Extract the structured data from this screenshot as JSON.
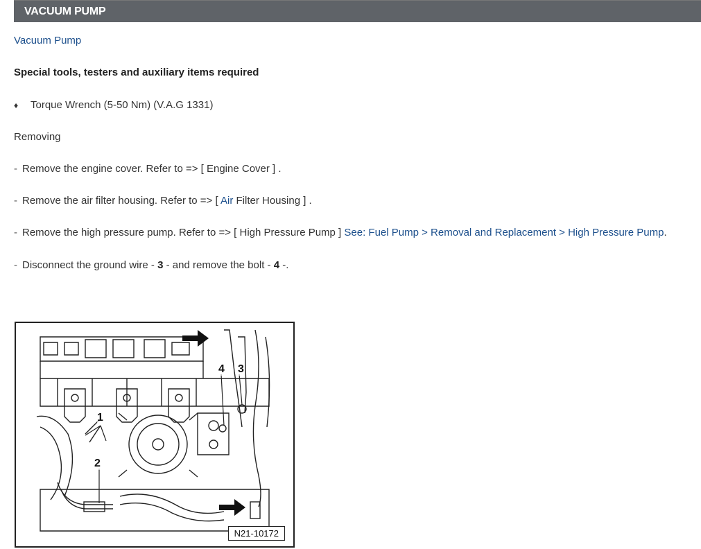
{
  "header": {
    "title": "VACUUM PUMP"
  },
  "doc": {
    "title": "Vacuum Pump",
    "tools_heading": "Special tools, testers and auxiliary items required",
    "tool_item": "Torque Wrench (5-50 Nm) (V.A.G 1331)",
    "removing_label": "Removing",
    "steps": [
      {
        "dash": "-",
        "text_a": "Remove the engine cover. Refer to => [ Engine Cover ] ."
      },
      {
        "dash": "-",
        "text_a": "Remove the air filter housing. Refer to => [ ",
        "link": "Air",
        "text_b": " Filter Housing ] ."
      },
      {
        "dash": "-",
        "text_a": "Remove the high pressure pump. Refer to => [ High Pressure Pump ] ",
        "link": "See: Fuel Pump > Removal and Replacement > High Pressure Pump",
        "text_b": "."
      },
      {
        "dash": "-",
        "text_a": "Disconnect the ground wire - ",
        "b1": "3",
        "text_b": " - and remove the bolt - ",
        "b2": "4",
        "text_c": " -."
      }
    ]
  },
  "figure": {
    "label": "N21-10172",
    "callouts": [
      "1",
      "2",
      "3",
      "4"
    ]
  },
  "icons": {
    "bullet": "diamond-bullet-icon",
    "arrows": "black-arrow-icon"
  }
}
